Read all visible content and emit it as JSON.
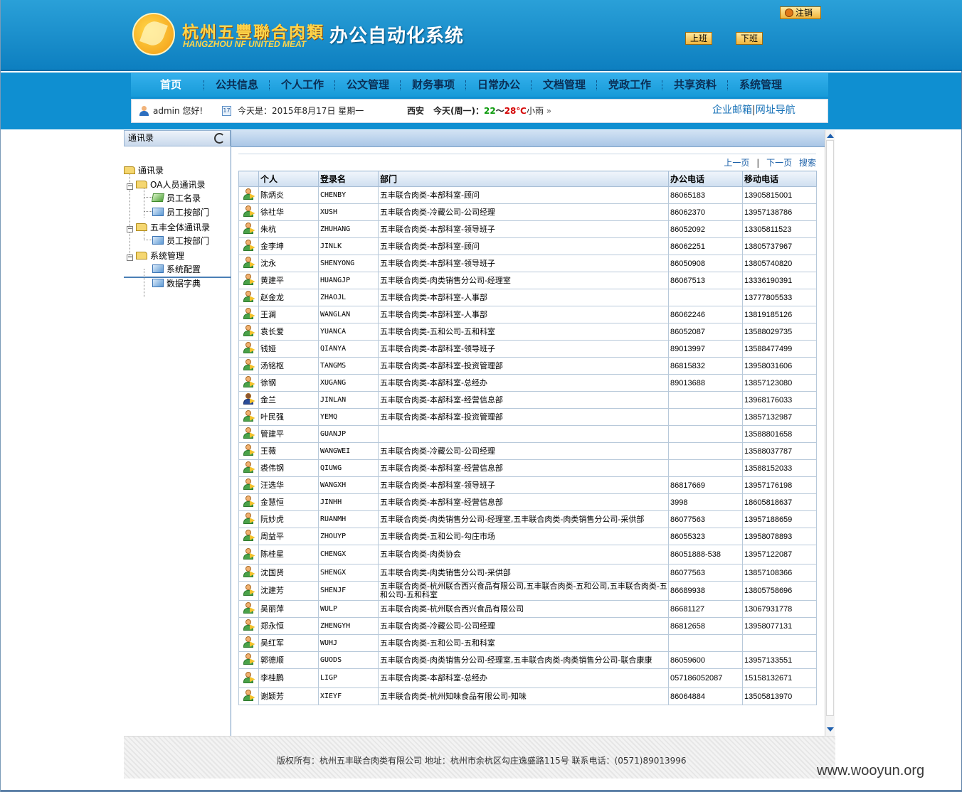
{
  "header": {
    "brand_cn": "杭州五豐聯合肉類",
    "brand_en": "HANGZHOU NF UNITED MEAT",
    "system_title": "办公自动化系统",
    "logout_label": "注销",
    "on_duty_label": "上班",
    "off_duty_label": "下班"
  },
  "nav": {
    "items": [
      "首页",
      "公共信息",
      "个人工作",
      "公文管理",
      "财务事项",
      "日常办公",
      "文档管理",
      "党政工作",
      "共享资料",
      "系统管理"
    ],
    "active_index": 0
  },
  "infobar": {
    "user": "admin 您好!",
    "date": "今天是：2015年8月17日 星期一",
    "city": "西安",
    "weather_prefix": "今天(周一)：",
    "temp_low": "22",
    "temp_sep": "～",
    "temp_high": "28℃",
    "weather_desc": "小雨",
    "mail_link": "企业邮箱",
    "link_sep": "|",
    "nav_link": "网址导航"
  },
  "sidebar": {
    "title": "通讯录",
    "tree": {
      "root": "通讯录",
      "group1": "OA人员通讯录",
      "group1_items": [
        "员工名录",
        "员工按部门"
      ],
      "group2": "五丰全体通讯录",
      "group2_items": [
        "员工按部门"
      ],
      "group3": "系统管理",
      "group3_items": [
        "系统配置",
        "数据字典"
      ]
    }
  },
  "main": {
    "pager": {
      "prev": "上一页",
      "sep": "|",
      "next": "下一页",
      "search": "搜索"
    },
    "columns": [
      "",
      "个人",
      "登录名",
      "部门",
      "办公电话",
      "移动电话"
    ],
    "rows": [
      {
        "name": "陈炳炎",
        "login": "CHENBY",
        "dept": "五丰联合肉类-本部科室-顾问",
        "office": "86065183",
        "mobile": "13905815001"
      },
      {
        "name": "徐社华",
        "login": "XUSH",
        "dept": "五丰联合肉类-冷藏公司-公司经理",
        "office": "86062370",
        "mobile": "13957138786"
      },
      {
        "name": "朱杭",
        "login": "ZHUHANG",
        "dept": "五丰联合肉类-本部科室-领导班子",
        "office": "86052092",
        "mobile": "13305811523"
      },
      {
        "name": "金李坤",
        "login": "JINLK",
        "dept": "五丰联合肉类-本部科室-顾问",
        "office": "86062251",
        "mobile": "13805737967"
      },
      {
        "name": "沈永",
        "login": "SHENYONG",
        "dept": "五丰联合肉类-本部科室-领导班子",
        "office": "86050908",
        "mobile": "13805740820"
      },
      {
        "name": "黄建平",
        "login": "HUANGJP",
        "dept": "五丰联合肉类-肉类销售分公司-经理室",
        "office": "86067513",
        "mobile": "13336190391"
      },
      {
        "name": "赵金龙",
        "login": "ZHAOJL",
        "dept": "五丰联合肉类-本部科室-人事部",
        "office": "",
        "mobile": "13777805533"
      },
      {
        "name": "王澜",
        "login": "WANGLAN",
        "dept": "五丰联合肉类-本部科室-人事部",
        "office": "86062246",
        "mobile": "13819185126"
      },
      {
        "name": "袁长爱",
        "login": "YUANCA",
        "dept": "五丰联合肉类-五和公司-五和科室",
        "office": "86052087",
        "mobile": "13588029735"
      },
      {
        "name": "钱娅",
        "login": "QIANYA",
        "dept": "五丰联合肉类-本部科室-领导班子",
        "office": "89013997",
        "mobile": "13588477499"
      },
      {
        "name": "汤铭枢",
        "login": "TANGMS",
        "dept": "五丰联合肉类-本部科室-投资管理部",
        "office": "86815832",
        "mobile": "13958031606"
      },
      {
        "name": "徐钢",
        "login": "XUGANG",
        "dept": "五丰联合肉类-本部科室-总经办",
        "office": "89013688",
        "mobile": "13857123080"
      },
      {
        "name": "金兰",
        "login": "JINLAN",
        "dept": "五丰联合肉类-本部科室-经营信息部",
        "office": "",
        "mobile": "13968176033",
        "alt_icon": true
      },
      {
        "name": "叶民强",
        "login": "YEMQ",
        "dept": "五丰联合肉类-本部科室-投资管理部",
        "office": "",
        "mobile": "13857132987"
      },
      {
        "name": "管建平",
        "login": "GUANJP",
        "dept": "",
        "office": "",
        "mobile": "13588801658"
      },
      {
        "name": "王薇",
        "login": "WANGWEI",
        "dept": "五丰联合肉类-冷藏公司-公司经理",
        "office": "",
        "mobile": "13588037787"
      },
      {
        "name": "裘伟钢",
        "login": "QIUWG",
        "dept": "五丰联合肉类-本部科室-经营信息部",
        "office": "",
        "mobile": "13588152033"
      },
      {
        "name": "汪选华",
        "login": "WANGXH",
        "dept": "五丰联合肉类-本部科室-领导班子",
        "office": "86817669",
        "mobile": "13957176198"
      },
      {
        "name": "金慧恒",
        "login": "JINHH",
        "dept": "五丰联合肉类-本部科室-经营信息部",
        "office": "3998",
        "mobile": "18605818637"
      },
      {
        "name": "阮妙虎",
        "login": "RUANMH",
        "dept": "五丰联合肉类-肉类销售分公司-经理室,五丰联合肉类-肉类销售分公司-采供部",
        "office": "86077563",
        "mobile": "13957188659"
      },
      {
        "name": "周益平",
        "login": "ZHOUYP",
        "dept": "五丰联合肉类-五和公司-勾庄市场",
        "office": "86055323",
        "mobile": "13958078893"
      },
      {
        "name": "陈桂星",
        "login": "CHENGX",
        "dept": "五丰联合肉类-肉类协会",
        "office": "86051888-538",
        "mobile": "13957122087"
      },
      {
        "name": "沈国贤",
        "login": "SHENGX",
        "dept": "五丰联合肉类-肉类销售分公司-采供部",
        "office": "86077563",
        "mobile": "13857108366"
      },
      {
        "name": "沈建芳",
        "login": "SHENJF",
        "dept": "五丰联合肉类-杭州联合西兴食品有限公司,五丰联合肉类-五和公司,五丰联合肉类-五和公司-五和科室",
        "office": "86689938",
        "mobile": "13805758696"
      },
      {
        "name": "吴丽萍",
        "login": "WULP",
        "dept": "五丰联合肉类-杭州联合西兴食品有限公司",
        "office": "86681127",
        "mobile": "13067931778"
      },
      {
        "name": "郑永恒",
        "login": "ZHENGYH",
        "dept": "五丰联合肉类-冷藏公司-公司经理",
        "office": "86812658",
        "mobile": "13958077131"
      },
      {
        "name": "吴红军",
        "login": "WUHJ",
        "dept": "五丰联合肉类-五和公司-五和科室",
        "office": "",
        "mobile": ""
      },
      {
        "name": "郭德顺",
        "login": "GUODS",
        "dept": "五丰联合肉类-肉类销售分公司-经理室,五丰联合肉类-肉类销售分公司-联合康康",
        "office": "86059600",
        "mobile": "13957133551"
      },
      {
        "name": "李桂鹏",
        "login": "LIGP",
        "dept": "五丰联合肉类-本部科室-总经办",
        "office": "057186052087",
        "mobile": "15158132671"
      },
      {
        "name": "谢颖芳",
        "login": "XIEYF",
        "dept": "五丰联合肉类-杭州知味食品有限公司-知味",
        "office": "86064884",
        "mobile": "13505813970"
      }
    ]
  },
  "footer": {
    "text": "版权所有：杭州五丰联合肉类有限公司 地址：杭州市余杭区勾庄逸盛路115号 联系电话：(0571)89013996"
  },
  "watermark": "www.wooyun.org"
}
